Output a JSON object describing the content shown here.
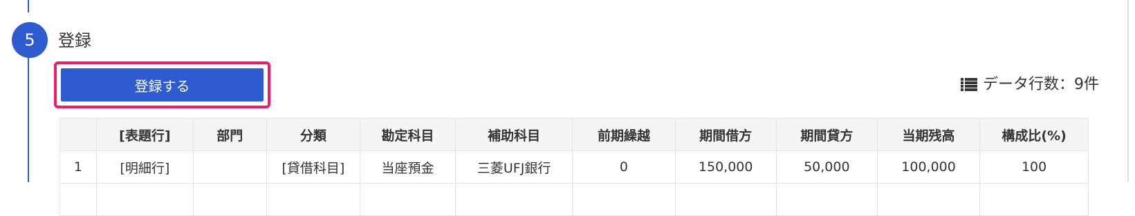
{
  "step": {
    "number": "5",
    "title": "登録"
  },
  "register_button": {
    "label": "登録する"
  },
  "data_count": {
    "label": "データ行数：9件"
  },
  "table": {
    "headers": [
      "",
      "[表題行]",
      "部門",
      "分類",
      "勘定科目",
      "補助科目",
      "前期繰越",
      "期間借方",
      "期間貸方",
      "当期残高",
      "構成比(%)"
    ],
    "rows": [
      [
        "1",
        "[明細行]",
        "",
        "[貸借科目]",
        "当座預金",
        "三菱UFJ銀行",
        "0",
        "150,000",
        "50,000",
        "100,000",
        "100"
      ],
      [
        "",
        "",
        "",
        "",
        "",
        "",
        "",
        "",
        "",
        "",
        ""
      ]
    ]
  },
  "colors": {
    "accent": "#2e5bd0",
    "highlight": "#ec1e67"
  }
}
